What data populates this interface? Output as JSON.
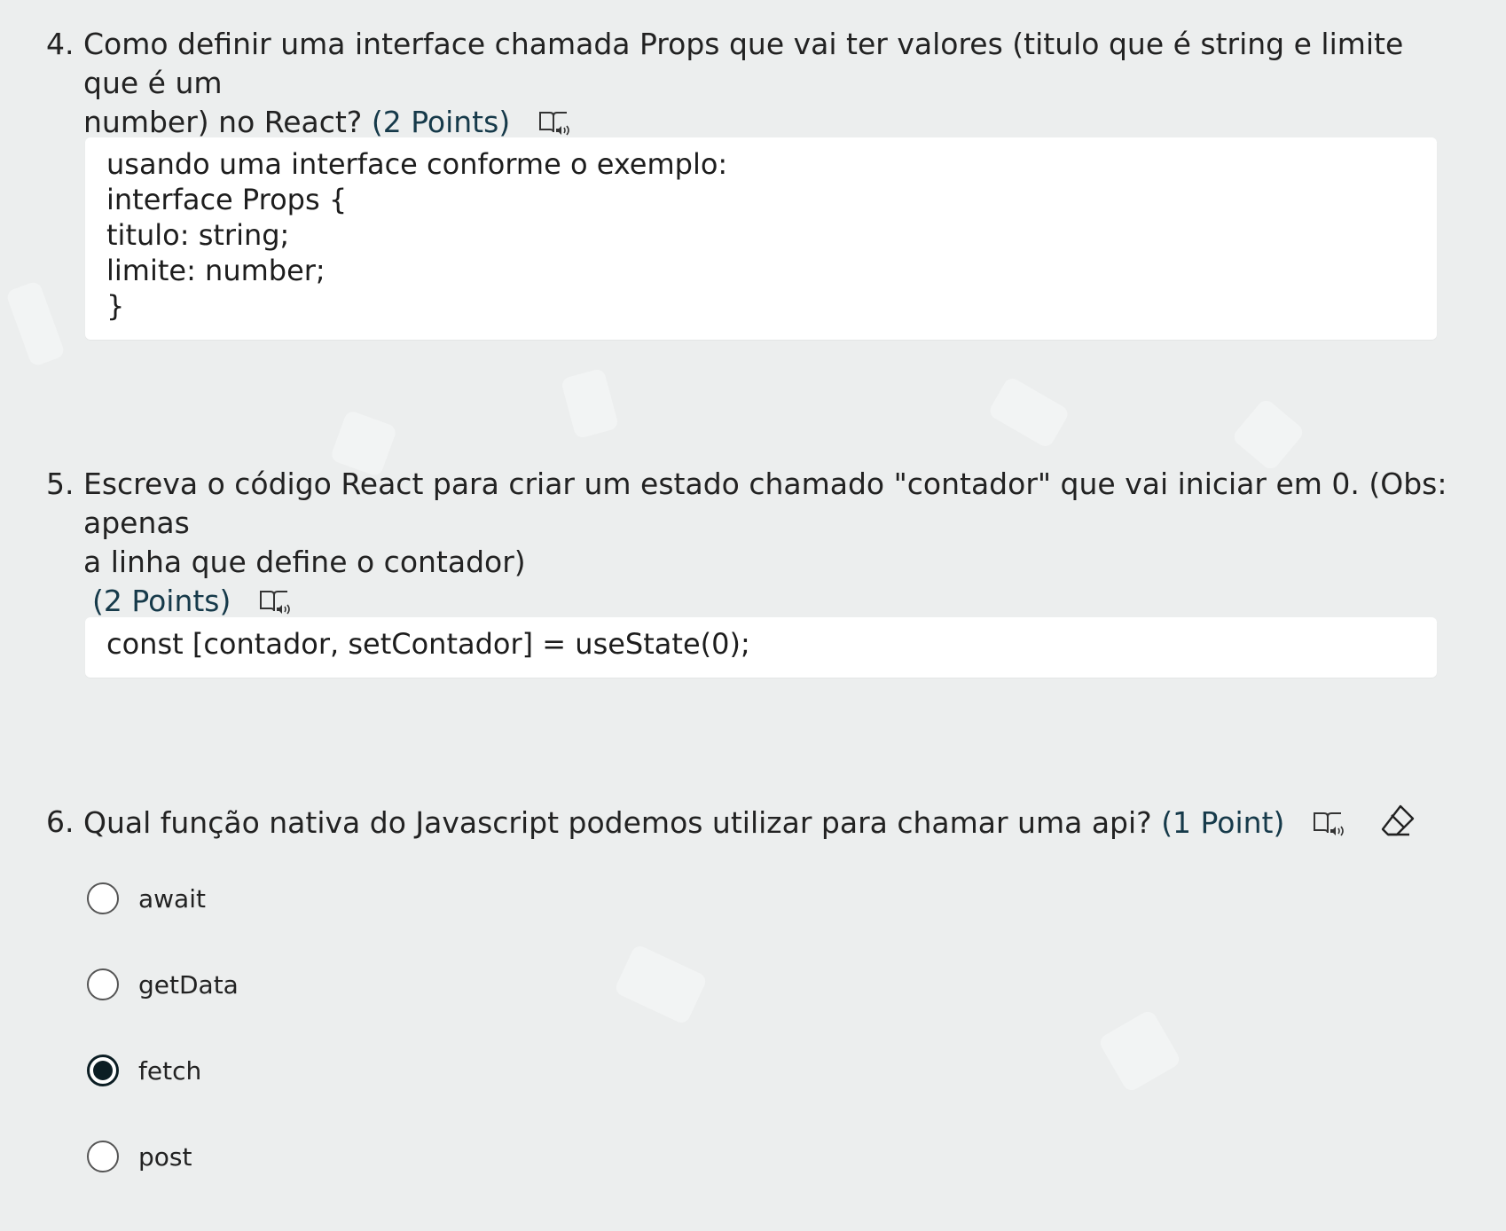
{
  "questions": [
    {
      "number": "4.",
      "text_line1": "Como definir uma interface chamada Props que vai ter valores (titulo que é string e limite que é um",
      "text_line2": "number) no React?",
      "points": "(2 Points)",
      "answer": "usando uma interface conforme o exemplo:\ninterface Props {\ntitulo: string;\nlimite: number;\n}"
    },
    {
      "number": "5.",
      "text_line1": "Escreva o código React para criar um estado chamado \"contador\" que vai iniciar em 0. (Obs: apenas",
      "text_line2": "a linha que define o contador)",
      "points": "(2 Points)",
      "answer": "const [contador, setContador] = useState(0);"
    },
    {
      "number": "6.",
      "text": "Qual função nativa do Javascript podemos utilizar para chamar uma api?",
      "points": "(1 Point)",
      "options": [
        {
          "label": "await",
          "selected": false
        },
        {
          "label": "getData",
          "selected": false
        },
        {
          "label": "fetch",
          "selected": true
        },
        {
          "label": "post",
          "selected": false
        }
      ]
    }
  ],
  "icons": {
    "immersive_reader": "immersive-reader-icon",
    "clear_answer": "eraser-icon"
  },
  "colors": {
    "background": "#eceeee",
    "points_text": "#163a4a",
    "radio_selected": "#0c1e24"
  }
}
